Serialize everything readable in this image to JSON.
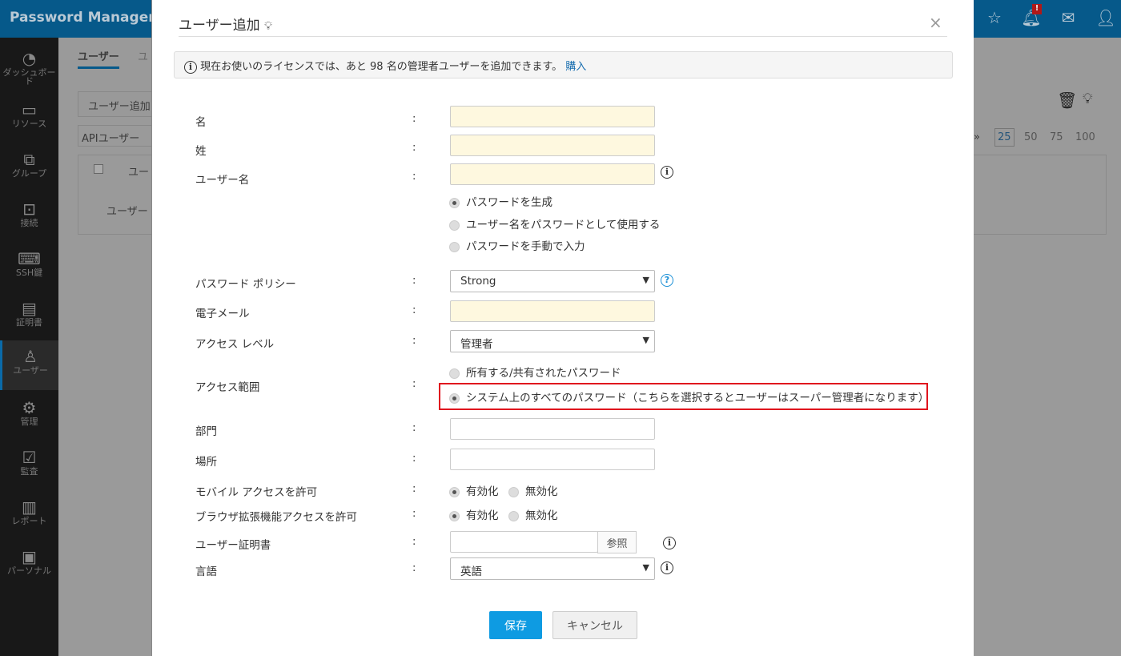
{
  "app": {
    "title": "Password Manager Pro"
  },
  "topbar": {
    "badge": "!"
  },
  "sidebar": {
    "items": [
      {
        "label": "ダッシュボード",
        "icon": "dashboard-icon"
      },
      {
        "label": "リソース",
        "icon": "monitor-icon"
      },
      {
        "label": "グループ",
        "icon": "group-icon"
      },
      {
        "label": "接続",
        "icon": "connection-icon"
      },
      {
        "label": "SSH鍵",
        "icon": "key-icon"
      },
      {
        "label": "証明書",
        "icon": "certificate-icon"
      },
      {
        "label": "ユーザー",
        "icon": "user-icon"
      },
      {
        "label": "管理",
        "icon": "gear-icon"
      },
      {
        "label": "監査",
        "icon": "clipboard-icon"
      },
      {
        "label": "レポート",
        "icon": "chart-icon"
      },
      {
        "label": "パーソナル",
        "icon": "contact-icon"
      }
    ]
  },
  "background": {
    "tab_users": "ユーザー",
    "tab_other": "ユ",
    "add_user_btn": "ユーザー追加",
    "filter": "APIユーザー",
    "col_user": "ユー",
    "row_user": "ユーザー",
    "page_sizes": [
      "25",
      "50",
      "75",
      "100"
    ]
  },
  "modal": {
    "title": "ユーザー追加",
    "close": "×",
    "notice": "現在お使いのライセンスでは、あと 98 名の管理者ユーザーを追加できます。",
    "notice_link": "購入",
    "colon": ":",
    "labels": {
      "first_name": "名",
      "last_name": "姓",
      "username": "ユーザー名",
      "policy": "パスワード ポリシー",
      "email": "電子メール",
      "access_level": "アクセス レベル",
      "access_scope": "アクセス範囲",
      "department": "部門",
      "location": "場所",
      "mobile": "モバイル アクセスを許可",
      "browser": "ブラウザ拡張機能アクセスを許可",
      "cert": "ユーザー証明書",
      "language": "言語"
    },
    "password_options": [
      "パスワードを生成",
      "ユーザー名をパスワードとして使用する",
      "パスワードを手動で入力"
    ],
    "policy_value": "Strong",
    "access_level_value": "管理者",
    "scope_options": [
      "所有する/共有されたパスワード",
      "システム上のすべてのパスワード（こちらを選択するとユーザーはスーパー管理者になります）"
    ],
    "enable": "有効化",
    "disable": "無効化",
    "browse": "参照",
    "language_value": "英語",
    "save": "保存",
    "cancel": "キャンセル"
  }
}
